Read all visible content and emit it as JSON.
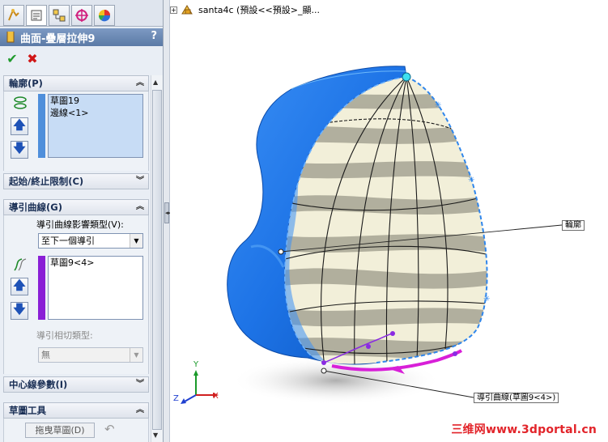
{
  "property_tabs": [
    {
      "icon": "feature-manager-icon"
    },
    {
      "icon": "property-manager-icon"
    },
    {
      "icon": "configuration-manager-icon"
    },
    {
      "icon": "dimxpert-icon"
    },
    {
      "icon": "display-manager-icon"
    }
  ],
  "feature": {
    "title": "曲面-疊層拉伸9",
    "help": "?",
    "ok": "✔",
    "cancel": "✖"
  },
  "profile_section": {
    "header": "輪廓(P)",
    "items": [
      "草圖19",
      "邊線<1>"
    ],
    "strip_color": "#4f8fdb"
  },
  "limits_section": {
    "header": "起始/終止限制(C)"
  },
  "guide_section": {
    "header": "導引曲線(G)",
    "influence_label": "導引曲線影響類型(V):",
    "influence_value": "至下一個導引",
    "items": [
      "草圖9<4>"
    ],
    "strip_color": "#8a1fd6",
    "tangency_label": "導引相切類型:",
    "tangency_value": "無"
  },
  "centerline_section": {
    "header": "中心線參數(I)"
  },
  "sketch_tools_section": {
    "header": "草圖工具",
    "drag_button": "拖曳草圖(D)",
    "undo_icon": "undo-icon"
  },
  "viewport": {
    "tree_item": "santa4c (預設<<預設>_顯...",
    "callout_profile": "輪廓",
    "callout_guide": "導引曲線(草圖9<4>)",
    "watermark": "三维网www.3dportal.cn",
    "axes": {
      "x": "X",
      "y": "Y",
      "z": "Z"
    }
  },
  "colors": {
    "model_blue": "#1d73e6",
    "guide_magenta": "#d81fd8",
    "profile_highlight": "#7fc8ff"
  }
}
